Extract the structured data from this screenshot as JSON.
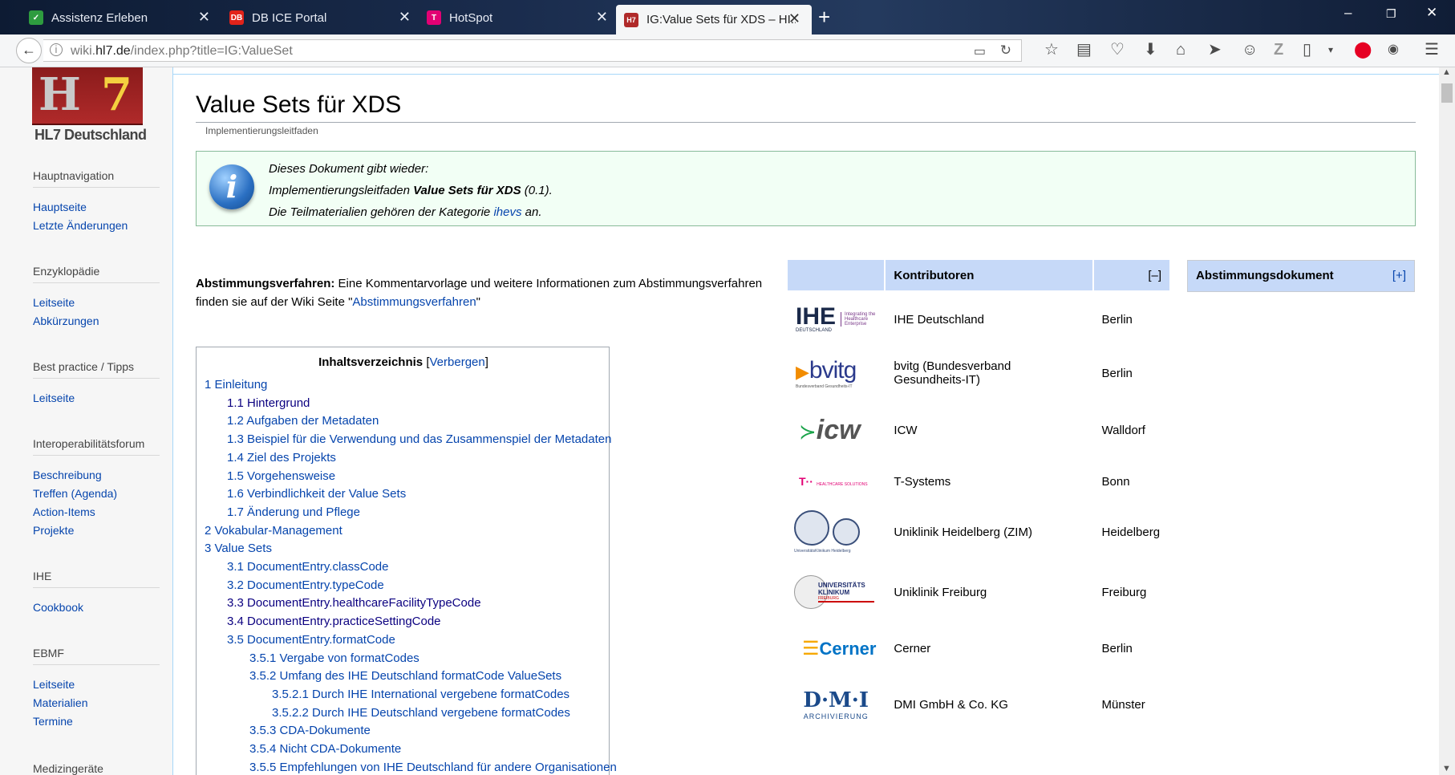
{
  "browser": {
    "tabs": [
      {
        "label": "Assistenz Erleben",
        "fav_color": "#2e9c3f",
        "fav": "✓"
      },
      {
        "label": "DB ICE Portal",
        "fav_color": "#e2231a",
        "fav": "DB"
      },
      {
        "label": "HotSpot",
        "fav_color": "#e20074",
        "fav": "T"
      },
      {
        "label": "IG:Value Sets für XDS – HI...",
        "fav_color": "#b02a2a",
        "fav": "H7"
      }
    ],
    "url_prefix": "wiki.",
    "url_host": "hl7.de",
    "url_path": "/index.php?title=IG:ValueSet"
  },
  "sidebar": {
    "logo_text": "HL7 Deutschland",
    "sections": [
      {
        "heading": "Hauptnavigation",
        "links": [
          "Hauptseite",
          "Letzte Änderungen"
        ]
      },
      {
        "heading": "Enzyklopädie",
        "links": [
          "Leitseite",
          "Abkürzungen"
        ]
      },
      {
        "heading": "Best practice / Tipps",
        "links": [
          "Leitseite"
        ]
      },
      {
        "heading": "Interoperabilitätsforum",
        "links": [
          "Beschreibung",
          "Treffen (Agenda)",
          "Action-Items",
          "Projekte"
        ]
      },
      {
        "heading": "IHE",
        "links": [
          "Cookbook"
        ]
      },
      {
        "heading": "EBMF",
        "links": [
          "Leitseite",
          "Materialien",
          "Termine"
        ]
      },
      {
        "heading": "Medizingeräte",
        "links": []
      }
    ]
  },
  "page": {
    "title": "Value Sets für XDS",
    "subtitle": "Implementierungsleitfaden",
    "info": {
      "line1": "Dieses Dokument gibt wieder:",
      "line2_pre": "Implementierungsleitfaden ",
      "line2_bold": "Value Sets für XDS",
      "line2_post": " (0.1).",
      "line3_pre": "Die Teilmaterialien gehören der Kategorie ",
      "line3_link": "ihevs",
      "line3_post": " an."
    },
    "abst": {
      "bold": "Abstimmungsverfahren:",
      "text": " Eine Kommentarvorlage und weitere Informationen zum Abstimmungsverfahren finden sie auf der Wiki Seite \"",
      "link": "Abstimmungsverfahren",
      "end": "\""
    }
  },
  "toc": {
    "title": "Inhaltsverzeichnis",
    "hide_open": "[",
    "hide": "Verbergen",
    "hide_close": "]",
    "items": [
      {
        "text": "1 Einleitung",
        "level": 0
      },
      {
        "text": "1.1 Hintergrund",
        "level": 1,
        "dark": true
      },
      {
        "text": "1.2 Aufgaben der Metadaten",
        "level": 1
      },
      {
        "text": "1.3 Beispiel für die Verwendung und das Zusammenspiel der Metadaten",
        "level": 1
      },
      {
        "text": "1.4 Ziel des Projekts",
        "level": 1
      },
      {
        "text": "1.5 Vorgehensweise",
        "level": 1
      },
      {
        "text": "1.6 Verbindlichkeit der Value Sets",
        "level": 1
      },
      {
        "text": "1.7 Änderung und Pflege",
        "level": 1
      },
      {
        "text": "2 Vokabular-Management",
        "level": 0
      },
      {
        "text": "3 Value Sets",
        "level": 0
      },
      {
        "text": "3.1 DocumentEntry.classCode",
        "level": 1
      },
      {
        "text": "3.2 DocumentEntry.typeCode",
        "level": 1
      },
      {
        "text": "3.3 DocumentEntry.healthcareFacilityTypeCode",
        "level": 1,
        "dark": true
      },
      {
        "text": "3.4 DocumentEntry.practiceSettingCode",
        "level": 1,
        "dark": true
      },
      {
        "text": "3.5 DocumentEntry.formatCode",
        "level": 1
      },
      {
        "text": "3.5.1 Vergabe von formatCodes",
        "level": 2
      },
      {
        "text": "3.5.2 Umfang des IHE Deutschland formatCode ValueSets",
        "level": 2
      },
      {
        "text": "3.5.2.1 Durch IHE International vergebene formatCodes",
        "level": 3
      },
      {
        "text": "3.5.2.2 Durch IHE Deutschland vergebene formatCodes",
        "level": 3
      },
      {
        "text": "3.5.3 CDA-Dokumente",
        "level": 2
      },
      {
        "text": "3.5.4 Nicht CDA-Dokumente",
        "level": 2
      },
      {
        "text": "3.5.5 Empfehlungen von IHE Deutschland für andere Organisationen",
        "level": 2
      }
    ]
  },
  "contributors": {
    "heading": "Kontributoren",
    "toggle": "[–]",
    "rows": [
      {
        "logo": "ihe",
        "name": "IHE Deutschland",
        "city": "Berlin",
        "logo_text": "IHE",
        "logo_sub": "DEUTSCHLAND",
        "logo_tag": "Integrating the Healthcare Enterprise"
      },
      {
        "logo": "bvitg",
        "name": "bvitg (Bundesverband Gesundheits-IT)",
        "city": "Berlin",
        "logo_text": "bvitg",
        "logo_sub": "Bundesverband Gesundheits-IT"
      },
      {
        "logo": "icw",
        "name": "ICW",
        "city": "Walldorf",
        "logo_text": "icw"
      },
      {
        "logo": "tsys",
        "name": "T-Systems",
        "city": "Bonn",
        "logo_text": "HEALTHCARE SOLUTIONS"
      },
      {
        "logo": "ukhd",
        "name": "Uniklinik Heidelberg (ZIM)",
        "city": "Heidelberg",
        "logo_sub": "UniversitätsKlinikum Heidelberg"
      },
      {
        "logo": "ukfr",
        "name": "Uniklinik Freiburg",
        "city": "Freiburg",
        "logo_text": "UNIVERSITÄTS KLINIKUM",
        "logo_sub": "FREIBURG"
      },
      {
        "logo": "cerner",
        "name": "Cerner",
        "city": "Berlin",
        "logo_text": "Cerner"
      },
      {
        "logo": "dmi",
        "name": "DMI GmbH & Co. KG",
        "city": "Münster",
        "logo_text": "D·M·I",
        "logo_sub": "ARCHIVIERUNG"
      }
    ]
  },
  "abstdoc": {
    "heading": "Abstimmungsdokument",
    "toggle": "[+]"
  }
}
